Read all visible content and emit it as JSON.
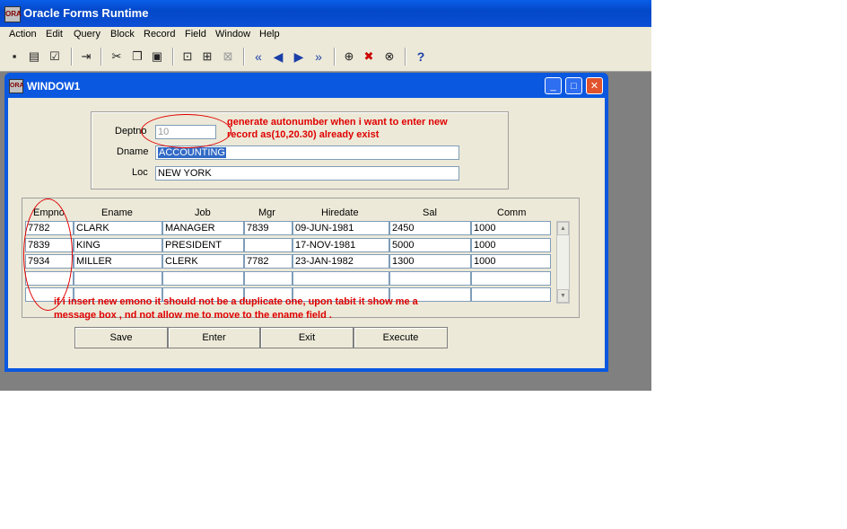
{
  "app": {
    "title": "Oracle Forms Runtime",
    "icon_text": "ORA"
  },
  "menu": [
    "Action",
    "Edit",
    "Query",
    "Block",
    "Record",
    "Field",
    "Window",
    "Help"
  ],
  "window": {
    "title": "WINDOW1",
    "icon_text": "ORA"
  },
  "dept": {
    "deptno_label": "Deptno",
    "deptno_value": "10",
    "dname_label": "Dname",
    "dname_value": "ACCOUNTING",
    "loc_label": "Loc",
    "loc_value": "NEW YORK"
  },
  "emp": {
    "columns": [
      "Empno",
      "Ename",
      "Job",
      "Mgr",
      "Hiredate",
      "Sal",
      "Comm"
    ],
    "rows": [
      [
        "7782",
        "CLARK",
        "MANAGER",
        "7839",
        "09-JUN-1981",
        "2450",
        "1000"
      ],
      [
        "7839",
        "KING",
        "PRESIDENT",
        "",
        "17-NOV-1981",
        "5000",
        "1000"
      ],
      [
        "7934",
        "MILLER",
        "CLERK",
        "7782",
        "23-JAN-1982",
        "1300",
        "1000"
      ],
      [
        "",
        "",
        "",
        "",
        "",
        "",
        ""
      ],
      [
        "",
        "",
        "",
        "",
        "",
        "",
        ""
      ]
    ]
  },
  "buttons": {
    "save": "Save",
    "enter": "Enter",
    "exit": "Exit",
    "execute": "Execute"
  },
  "annotations": {
    "note1_line1": "generate autonumber when i want to enter new",
    "note1_line2": "record as(10,20.30) already exist",
    "note2_line1": "if i insert new emono it should not be a duplicate one, upon tabit it show me a",
    "note2_line2": "message box , nd not allow me to move to the ename field ."
  },
  "colors": {
    "titlebar": "#0348c8",
    "annotation": "#e00000",
    "selection": "#316ac5"
  }
}
